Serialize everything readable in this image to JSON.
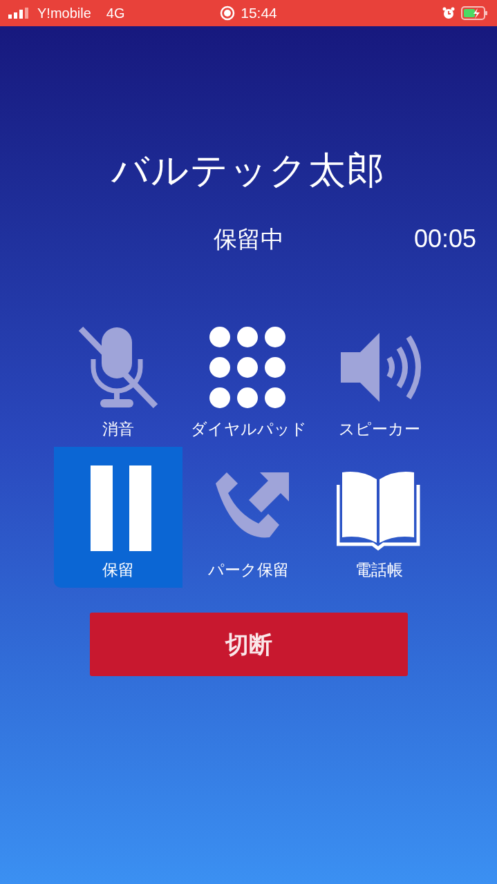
{
  "status_bar": {
    "carrier": "Y!mobile",
    "network": "4G",
    "time": "15:44"
  },
  "caller_name": "バルテック太郎",
  "call_state": "保留中",
  "timer": "00:05",
  "buttons": [
    {
      "kind": "mute",
      "label": "消音",
      "selected": false,
      "enabled": false
    },
    {
      "kind": "dialpad",
      "label": "ダイヤルパッド",
      "selected": false,
      "enabled": true
    },
    {
      "kind": "speaker",
      "label": "スピーカー",
      "selected": false,
      "enabled": false
    },
    {
      "kind": "hold",
      "label": "保留",
      "selected": true,
      "enabled": true
    },
    {
      "kind": "park",
      "label": "パーク保留",
      "selected": false,
      "enabled": false
    },
    {
      "kind": "phonebook",
      "label": "電話帳",
      "selected": false,
      "enabled": true
    }
  ],
  "end_button": {
    "label": "切断"
  }
}
